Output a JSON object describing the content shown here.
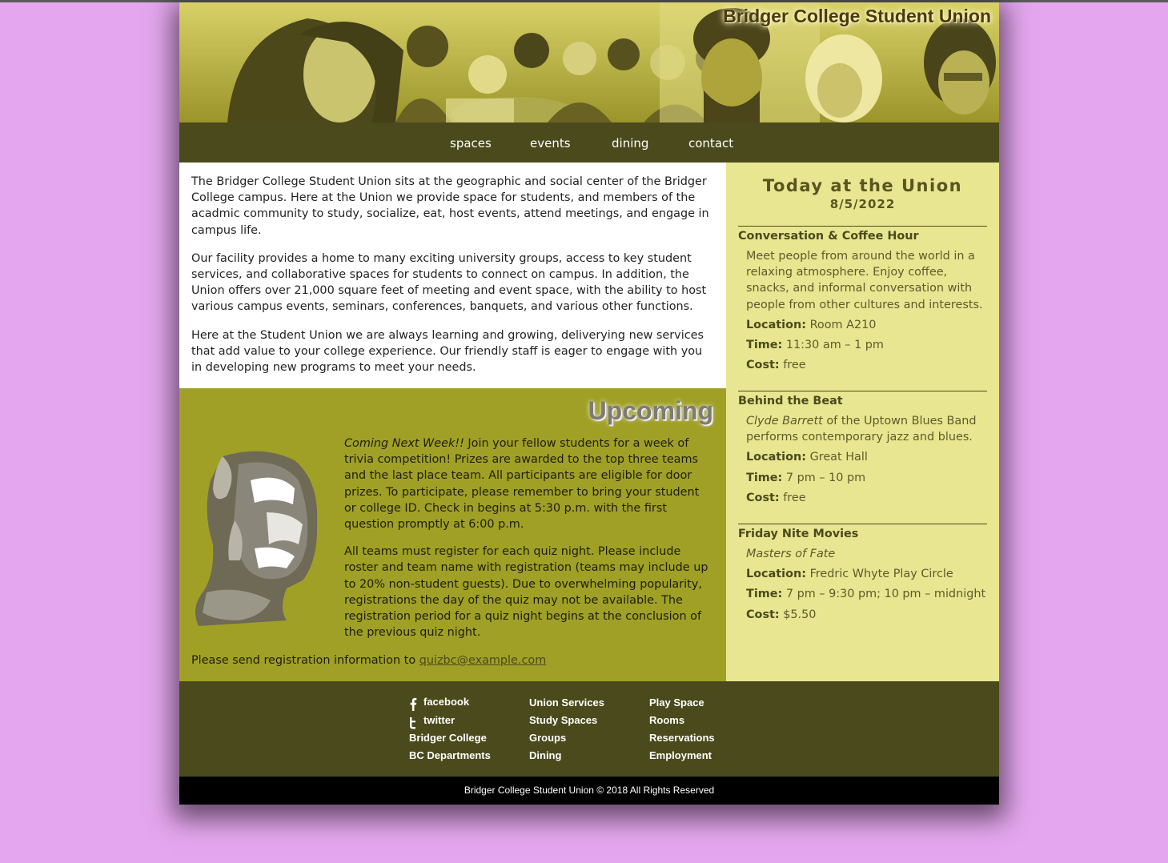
{
  "header": {
    "title": "Bridger College Student Union"
  },
  "nav": {
    "items": [
      "spaces",
      "events",
      "dining",
      "contact"
    ]
  },
  "intro": {
    "paragraphs": [
      "The Bridger College Student Union sits at the geographic and social center of the Bridger College campus. Here at the Union we provide space for students, and members of the acadmic community to study, socialize, eat, host events, attend meetings, and engage in campus life.",
      "Our facility provides a home to many exciting university groups, access to key student services, and collaborative spaces for students to connect on campus. In addition, the Union offers over 21,000 square feet of meeting and event space, with the ability to host various campus events, seminars, conferences, banquets, and various other functions.",
      "Here at the Student Union we are always learning and growing, deliverying new services that add value to your college experience. Our friendly staff is eager to engage with you in developing new programs to meet your needs."
    ]
  },
  "upcoming": {
    "title": "Upcoming",
    "lead_emphasis": "Coming Next Week!!",
    "lead_text": " Join your fellow students for a week of trivia competition! Prizes are awarded to the top three teams and the last place team. All participants are eligible for door prizes. To participate, please remember to bring your student or college ID. Check in begins at 5:30 p.m. with the first question promptly at 6:00 p.m.",
    "paragraph2": "All teams must register for each quiz night. Please include roster and team name with registration (teams may include up to 20% non-student guests). Due to overwhelming popularity, registrations the day of the quiz may not be available. The registration period for a quiz night begins at the conclusion of the previous quiz night.",
    "send_text": "Please send registration information to ",
    "email": "quizbc@example.com"
  },
  "sidebar": {
    "title": "Today at the Union",
    "date": "8/5/2022",
    "labels": {
      "location": "Location:",
      "time": "Time:",
      "cost": "Cost:"
    },
    "events": [
      {
        "name": "Conversation & Coffee Hour",
        "desc": "Meet people from around the world in a relaxing atmosphere. Enjoy coffee, snacks, and informal conversation with people from other cultures and interests.",
        "location": "Room A210",
        "time": "11:30 am – 1 pm",
        "cost": "free"
      },
      {
        "name": "Behind the Beat",
        "desc_em": "Clyde Barrett",
        "desc": " of the Uptown Blues Band performs contemporary jazz and blues.",
        "location": "Great Hall",
        "time": "7 pm – 10 pm",
        "cost": "free"
      },
      {
        "name": "Friday Nite Movies",
        "desc_em": "Masters of Fate",
        "location": "Fredric Whyte Play Circle",
        "time": "7 pm – 9:30 pm; 10 pm – midnight",
        "cost": "$5.50"
      }
    ]
  },
  "footer": {
    "col1": [
      "facebook",
      "twitter",
      "Bridger College",
      "BC Departments"
    ],
    "col2": [
      "Union Services",
      "Study Spaces",
      "Groups",
      "Dining"
    ],
    "col3": [
      "Play Space",
      "Rooms",
      "Reservations",
      "Employment"
    ],
    "icons": [
      "facebook-icon",
      "twitter-icon"
    ],
    "copyright": "Bridger College Student Union © 2018 All Rights Reserved"
  },
  "colors": {
    "page_bg": "#e4a6ee",
    "nav_bg": "#4b4a1c",
    "upcoming_bg": "#a0a026",
    "sidebar_bg": "#e8e691",
    "copyright_bg": "#000000"
  }
}
